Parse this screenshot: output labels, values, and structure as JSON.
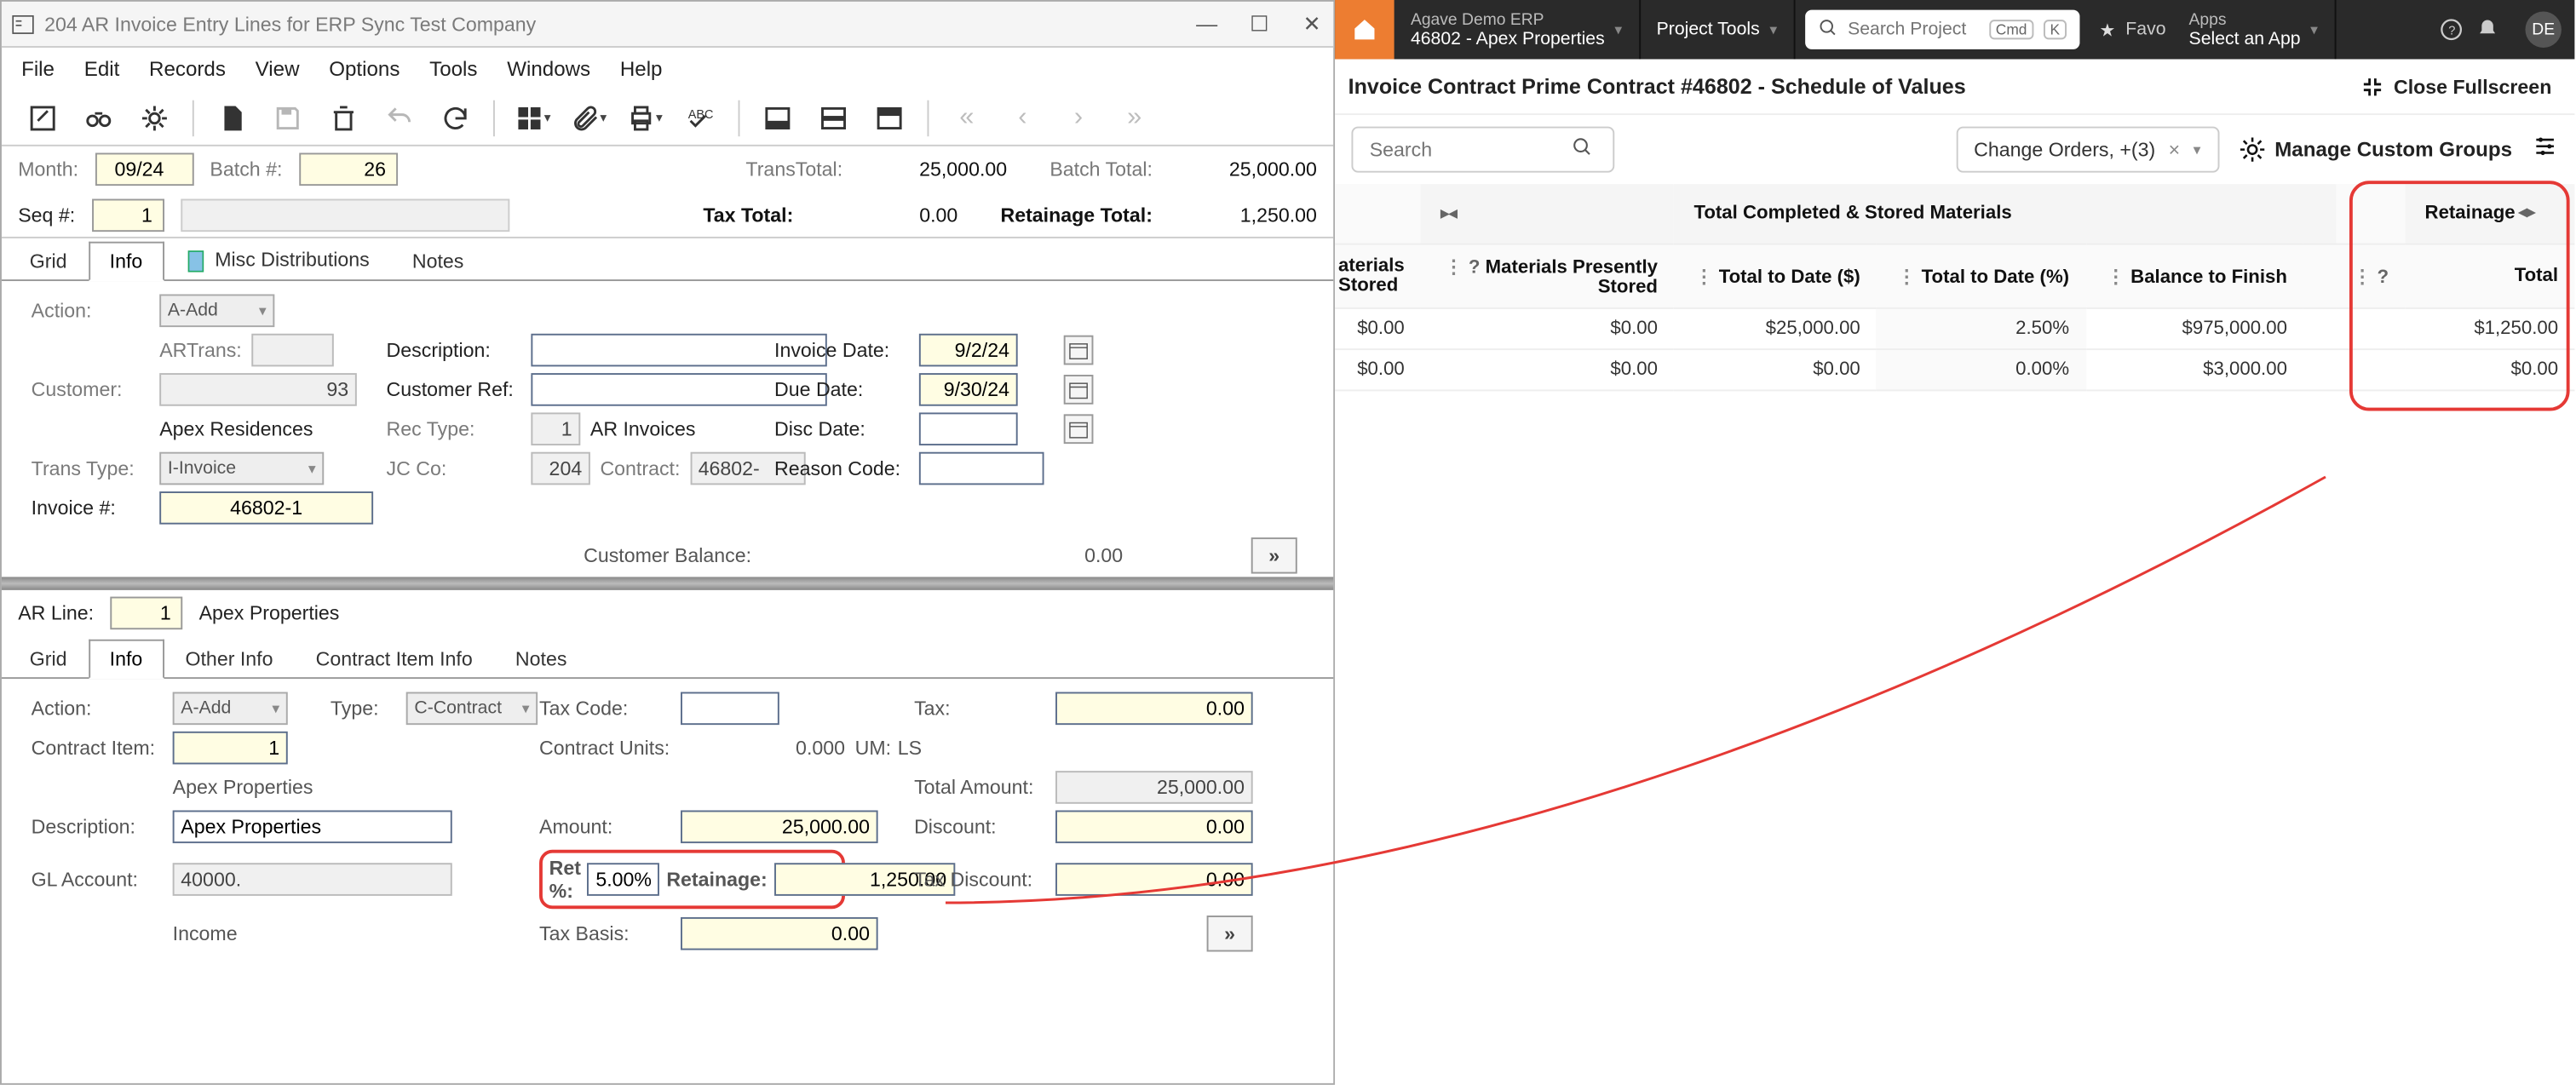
{
  "erp": {
    "title": "204 AR Invoice Entry Lines for ERP Sync Test Company",
    "menu": [
      "File",
      "Edit",
      "Records",
      "View",
      "Options",
      "Tools",
      "Windows",
      "Help"
    ],
    "header": {
      "month_label": "Month:",
      "month": "09/24",
      "batch_label": "Batch #:",
      "batch": "26",
      "transtotal_label": "TransTotal:",
      "transtotal": "25,000.00",
      "batchtotal_label": "Batch Total:",
      "batchtotal": "25,000.00",
      "seq_label": "Seq #:",
      "seq": "1",
      "taxtotal_label": "Tax Total:",
      "taxtotal": "0.00",
      "retainagetotal_label": "Retainage Total:",
      "retainagetotal": "1,250.00"
    },
    "tabs_top": {
      "grid": "Grid",
      "info": "Info",
      "misc": "Misc Distributions",
      "notes": "Notes"
    },
    "info": {
      "action_label": "Action:",
      "action": "A-Add",
      "artrans_label": "ARTrans:",
      "artrans": "",
      "description_label": "Description:",
      "description": "",
      "invoicedate_label": "Invoice Date:",
      "invoicedate": "9/2/24",
      "customer_label": "Customer:",
      "customer": "93",
      "customer_name": "Apex Residences",
      "customerref_label": "Customer Ref:",
      "customerref": "",
      "duedate_label": "Due Date:",
      "duedate": "9/30/24",
      "rectype_label": "Rec Type:",
      "rectype_no": "1",
      "rectype": "AR Invoices",
      "discdate_label": "Disc Date:",
      "discdate": "",
      "transtype_label": "Trans Type:",
      "transtype": "I-Invoice",
      "jcco_label": "JC Co:",
      "jcco": "204",
      "contract_label": "Contract:",
      "contract": "46802-",
      "reason_label": "Reason Code:",
      "reason": "",
      "invoiceno_label": "Invoice #:",
      "invoiceno": "46802-1",
      "custbal_label": "Customer Balance:",
      "custbal": "0.00"
    },
    "arline": {
      "label": "AR Line:",
      "value": "1",
      "name": "Apex Properties"
    },
    "tabs_bot": {
      "grid": "Grid",
      "info": "Info",
      "other": "Other Info",
      "contractitem": "Contract Item Info",
      "notes": "Notes"
    },
    "line": {
      "action_label": "Action:",
      "action": "A-Add",
      "type_label": "Type:",
      "type": "C-Contract",
      "taxcode_label": "Tax Code:",
      "taxcode": "",
      "tax_label": "Tax:",
      "tax": "0.00",
      "contractitem_label": "Contract Item:",
      "contractitem": "1",
      "contractitem_name": "Apex Properties",
      "contractunits_label": "Contract Units:",
      "contractunits": "0.000",
      "um_label": "UM:",
      "um": "LS",
      "totalamount_label": "Total Amount:",
      "totalamount": "25,000.00",
      "description_label": "Description:",
      "description": "Apex Properties",
      "amount_label": "Amount:",
      "amount": "25,000.00",
      "discount_label": "Discount:",
      "discount": "0.00",
      "glaccount_label": "GL Account:",
      "glaccount": "40000.",
      "glaccount_name": "Income",
      "retpct_label": "Ret %:",
      "retpct": "5.00%",
      "retainage_label": "Retainage:",
      "retainage": "1,250.00",
      "taxdiscount_label": "Tax Discount:",
      "taxdiscount": "0.00",
      "taxbasis_label": "Tax Basis:",
      "taxbasis": "0.00"
    }
  },
  "web": {
    "nav": {
      "company": "Agave Demo ERP",
      "project": "46802 - Apex Properties",
      "tools": "Project Tools",
      "search_placeholder": "Search Project",
      "kbd1": "Cmd",
      "kbd2": "K",
      "favo": "Favo",
      "apps": "Apps",
      "select_app": "Select an App",
      "avatar": "DE"
    },
    "title": "Invoice Contract Prime Contract #46802 - Schedule of Values",
    "close": "Close Fullscreen",
    "search_placeholder": "Search",
    "filter": "Change Orders, +(3)",
    "manage": "Manage Custom Groups",
    "grouphdr": {
      "tcs": "Total Completed & Stored Materials",
      "ret": "Retainage"
    },
    "cols": {
      "materials_stored": "aterials\nStored",
      "mps": "Materials Presently Stored",
      "ttd": "Total to Date ($)",
      "ttdp": "Total to Date (%)",
      "btf": "Balance to Finish",
      "total": "Total"
    },
    "rows": [
      {
        "ms": "$0.00",
        "mps": "$0.00",
        "ttd": "$25,000.00",
        "ttdp": "2.50%",
        "btf": "$975,000.00",
        "total": "$1,250.00"
      },
      {
        "ms": "$0.00",
        "mps": "$0.00",
        "ttd": "$0.00",
        "ttdp": "0.00%",
        "btf": "$3,000.00",
        "total": "$0.00"
      }
    ]
  }
}
